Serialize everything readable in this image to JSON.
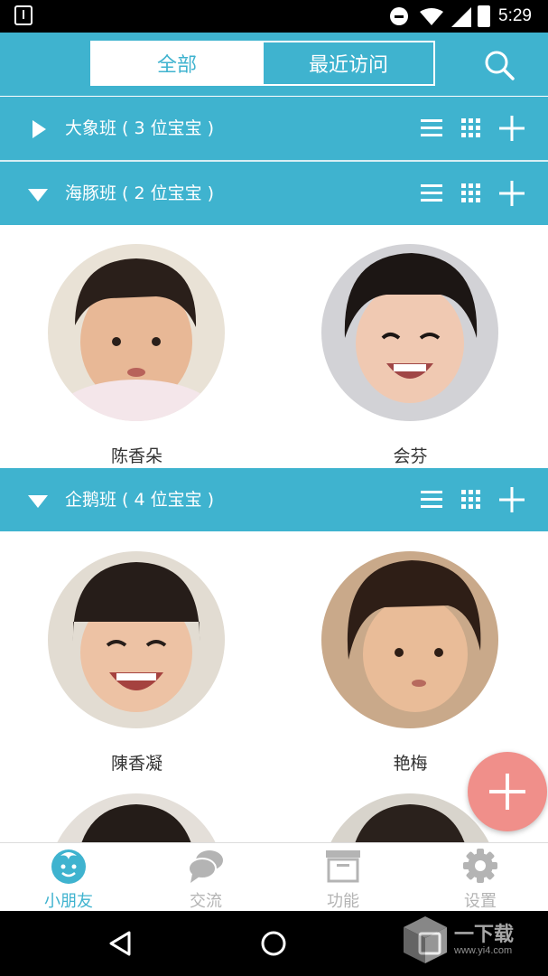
{
  "status_bar": {
    "time": "5:29"
  },
  "header": {
    "tabs": [
      {
        "label": "全部",
        "active": true
      },
      {
        "label": "最近访问",
        "active": false
      }
    ]
  },
  "groups": [
    {
      "title": "大象班 ( 3 位宝宝 )",
      "expanded": false
    },
    {
      "title": "海豚班 ( 2 位宝宝 )",
      "expanded": true,
      "children": [
        "陈香朵",
        "会芬"
      ]
    },
    {
      "title": "企鹅班 ( 4 位宝宝 )",
      "expanded": true,
      "children": [
        "陳香凝",
        "艳梅"
      ]
    }
  ],
  "bottom_nav": [
    {
      "label": "小朋友",
      "icon": "baby-face-icon",
      "active": true
    },
    {
      "label": "交流",
      "icon": "chat-bubbles-icon",
      "active": false
    },
    {
      "label": "功能",
      "icon": "archive-box-icon",
      "active": false
    },
    {
      "label": "设置",
      "icon": "gear-icon",
      "active": false
    }
  ],
  "watermark": {
    "brand": "一下载",
    "url": "www.yi4.com"
  },
  "colors": {
    "primary": "#3fb3cf",
    "fab": "#f08f8a",
    "inactive": "#b4b4b4"
  }
}
